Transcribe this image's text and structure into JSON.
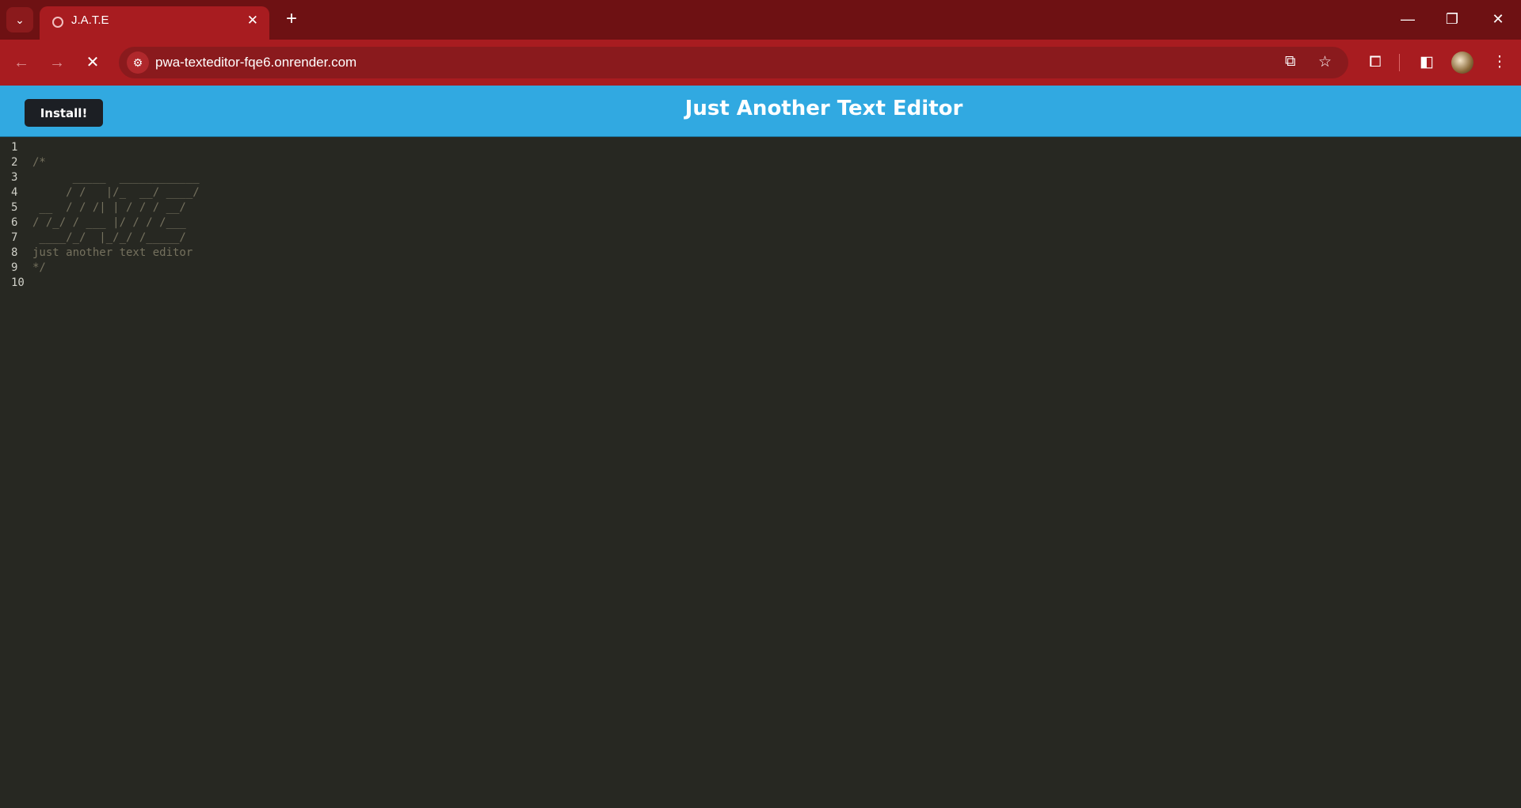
{
  "browser": {
    "tab": {
      "title": "J.A.T.E",
      "close": "✕"
    },
    "new_tab": "+",
    "url": "pwa-texteditor-fqe6.onrender.com",
    "window": {
      "minimize": "—",
      "restore": "❐",
      "close": "✕"
    }
  },
  "app": {
    "install_label": "Install!",
    "title": "Just Another Text Editor"
  },
  "editor": {
    "line_numbers": [
      "1",
      "2",
      "3",
      "4",
      "5",
      "6",
      "7",
      "8",
      "9",
      "10"
    ],
    "lines": [
      "",
      "/*",
      "      _____  ____________",
      "     / /   |/_  __/ ____/",
      " __  / / /| | / / / __/",
      "/ /_/ / ___ |/ / / /___",
      " ____/_/  |_/_/ /_____/",
      "just another text editor",
      "*/",
      ""
    ]
  },
  "colors": {
    "browser_frame": "#6e1113",
    "browser_toolbar": "#a81c20",
    "app_header": "#31a9e1",
    "editor_bg": "#272822",
    "comment": "#75715e"
  }
}
